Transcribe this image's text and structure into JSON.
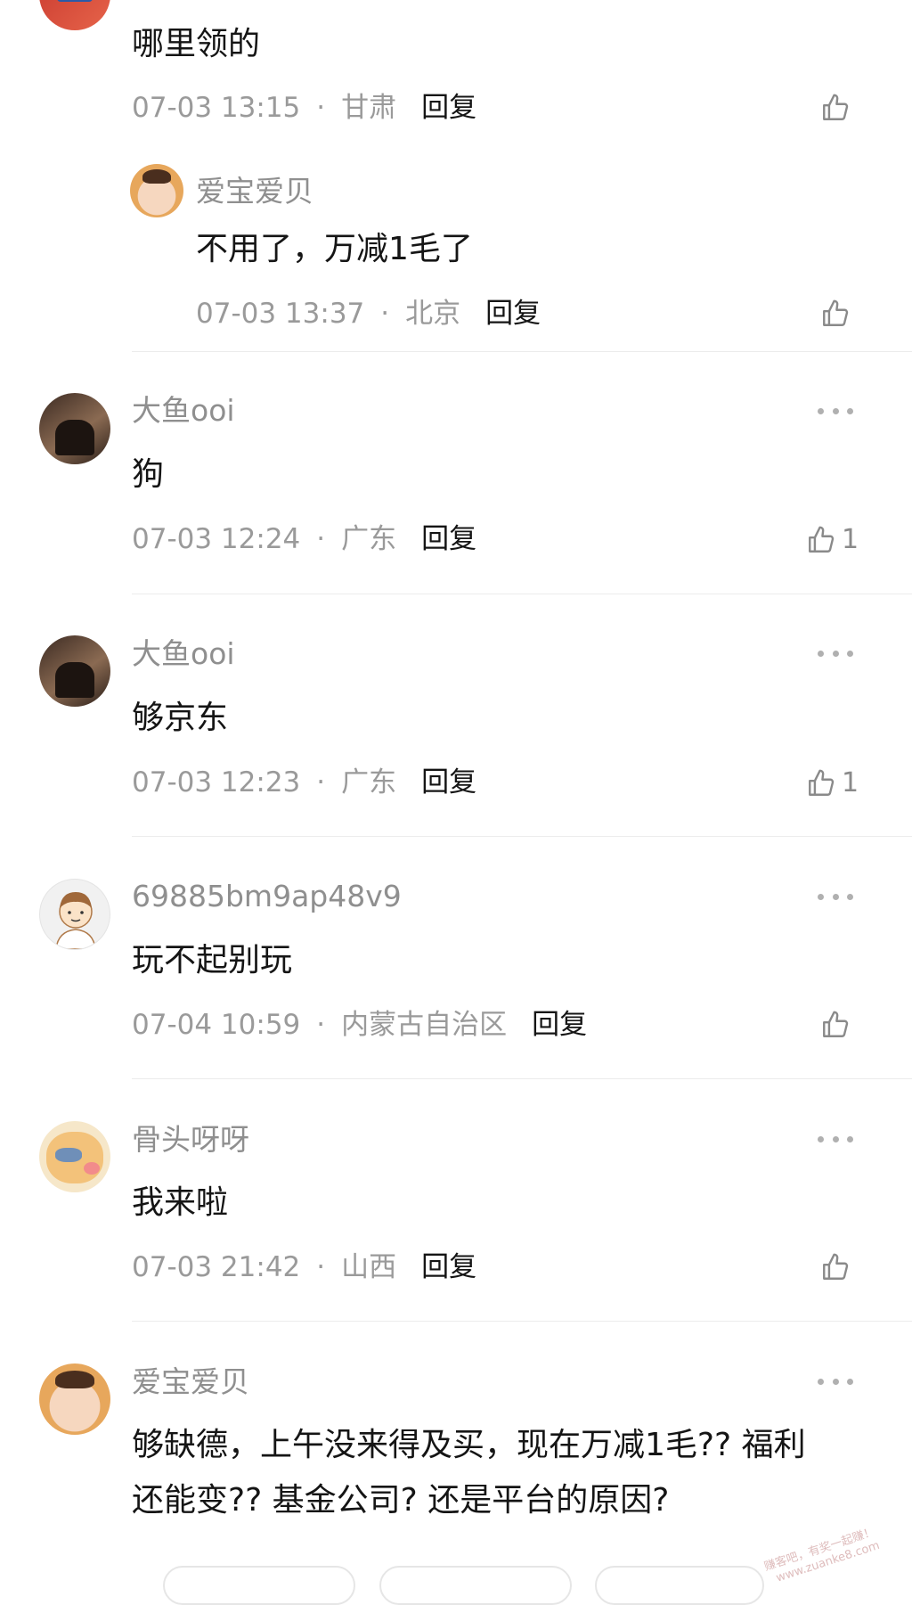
{
  "comments": [
    {
      "user": "",
      "content": "哪里领的",
      "time": "07-03 13:15",
      "location": "甘肃",
      "reply": "回复",
      "likes": ""
    },
    {
      "user": "爱宝爱贝",
      "content": "不用了，万减1毛了",
      "time": "07-03 13:37",
      "location": "北京",
      "reply": "回复",
      "likes": ""
    },
    {
      "user": "大鱼ooi",
      "content": "狗",
      "time": "07-03 12:24",
      "location": "广东",
      "reply": "回复",
      "likes": "1"
    },
    {
      "user": "大鱼ooi",
      "content": "够京东",
      "time": "07-03 12:23",
      "location": "广东",
      "reply": "回复",
      "likes": "1"
    },
    {
      "user": "69885bm9ap48v9",
      "content": "玩不起别玩",
      "time": "07-04 10:59",
      "location": "内蒙古自治区",
      "reply": "回复",
      "likes": ""
    },
    {
      "user": "骨头呀呀",
      "content": "我来啦",
      "time": "07-03 21:42",
      "location": "山西",
      "reply": "回复",
      "likes": ""
    },
    {
      "user": "爱宝爱贝",
      "content_line1": "够缺德，上午没来得及买，现在万减1毛?? 福利",
      "content_line2": "还能变?? 基金公司? 还是平台的原因?"
    }
  ],
  "separator": "·",
  "icons": {
    "like": "thumbs-up-icon",
    "more": "more-horizontal-icon"
  },
  "watermark": {
    "line1": "赚客吧，有奖一起赚！",
    "line2": "www.zuanke8.com"
  }
}
